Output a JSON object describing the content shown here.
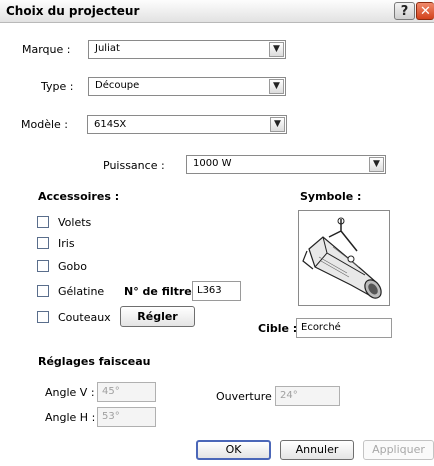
{
  "window": {
    "title": "Choix du projecteur",
    "help_label": "?",
    "close_label": "✕"
  },
  "fields": {
    "marque": {
      "label": "Marque :",
      "value": "Juliat"
    },
    "type": {
      "label": "Type :",
      "value": "Découpe"
    },
    "modele": {
      "label": "Modèle :",
      "value": "614SX"
    },
    "puissance": {
      "label": "Puissance :",
      "value": "1000 W"
    }
  },
  "accessories": {
    "heading": "Accessoires :",
    "items": [
      {
        "label": "Volets",
        "checked": false
      },
      {
        "label": "Iris",
        "checked": false
      },
      {
        "label": "Gobo",
        "checked": false
      },
      {
        "label": "Gélatine",
        "checked": false
      },
      {
        "label": "Couteaux",
        "checked": false
      }
    ],
    "filter_label": "N° de filtre",
    "filter_value": "L363",
    "adjust_button": "Régler"
  },
  "symbol": {
    "heading": "Symbole :",
    "icon": "spotlight-projector-icon"
  },
  "cible": {
    "label": "Cible :",
    "value": "Ecorché"
  },
  "beam": {
    "heading": "Réglages faisceau",
    "angle_v": {
      "label": "Angle V :",
      "value": "45°"
    },
    "angle_h": {
      "label": "Angle H :",
      "value": "53°"
    },
    "ouverture": {
      "label": "Ouverture :",
      "value": "24°"
    }
  },
  "buttons": {
    "ok": "OK",
    "cancel": "Annuler",
    "apply": "Appliquer"
  }
}
